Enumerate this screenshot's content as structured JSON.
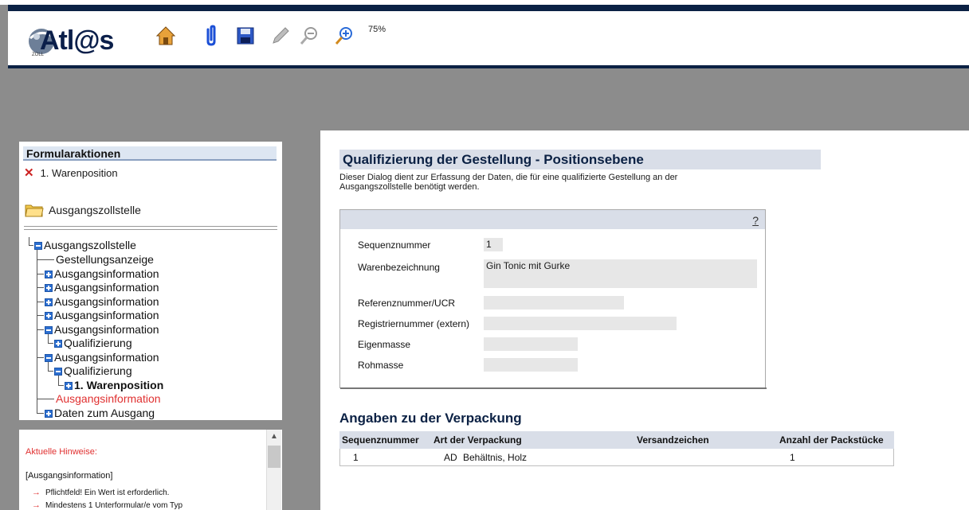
{
  "app": {
    "logo_text": "Atl@s",
    "logo_sub": "ZOLL",
    "zoom_level": "75%"
  },
  "toolbar": {
    "icons": [
      "home-icon",
      "paperclip-icon",
      "save-icon",
      "pencil-icon",
      "zoom-out-icon",
      "zoom-in-icon"
    ]
  },
  "formular_aktionen": {
    "title": "Formularaktionen",
    "item_label": "1. Warenposition",
    "folder_label": "Ausgangszollstelle"
  },
  "tree": [
    {
      "label": "Ausgangszollstelle",
      "box": "minus",
      "level": 0
    },
    {
      "label": "Gestellungsanzeige",
      "box": "none",
      "level": 1
    },
    {
      "label": "Ausgangsinformation",
      "box": "plus",
      "level": 1
    },
    {
      "label": "Ausgangsinformation",
      "box": "plus",
      "level": 1
    },
    {
      "label": "Ausgangsinformation",
      "box": "plus",
      "level": 1
    },
    {
      "label": "Ausgangsinformation",
      "box": "plus",
      "level": 1
    },
    {
      "label": "Ausgangsinformation",
      "box": "minus",
      "level": 1
    },
    {
      "label": "Qualifizierung",
      "box": "plus",
      "level": 2
    },
    {
      "label": "Ausgangsinformation",
      "box": "minus",
      "level": 1
    },
    {
      "label": "Qualifizierung",
      "box": "minus",
      "level": 2
    },
    {
      "label": "1. Warenposition",
      "box": "plus",
      "level": 3,
      "bold": true
    },
    {
      "label": "Ausgangsinformation",
      "box": "none",
      "level": 1,
      "red": true
    },
    {
      "label": "Daten zum Ausgang",
      "box": "plus",
      "level": 1
    }
  ],
  "hints": {
    "title": "Aktuelle Hinweise:",
    "context": "[Ausgangsinformation]",
    "lines": [
      "Pflichtfeld! Ein Wert ist erforderlich.",
      "Mindestens 1 Unterformular/e vom Typ"
    ]
  },
  "main": {
    "title": "Qualifizierung der Gestellung - Positionsebene",
    "description": "Dieser Dialog dient zur Erfassung der Daten, die für eine qualifizierte Gestellung an der Ausgangszollstelle benötigt werden.",
    "help": "?",
    "fields": [
      {
        "label": "Sequenznummer",
        "value": "1"
      },
      {
        "label": "Warenbezeichnung",
        "value": "Gin Tonic mit Gurke"
      },
      {
        "label": "Referenznummer/UCR",
        "value": ""
      },
      {
        "label": "Registriernummer (extern)",
        "value": ""
      },
      {
        "label": "Eigenmasse",
        "value": ""
      },
      {
        "label": "Rohmasse",
        "value": ""
      }
    ]
  },
  "packaging": {
    "title": "Angaben zu der Verpackung",
    "headers": [
      "Sequenznummer",
      "Art der Verpackung",
      "Versandzeichen",
      "Anzahl der Packstücke"
    ],
    "rows": [
      {
        "seq": "1",
        "code": "AD",
        "art": "Behältnis, Holz",
        "versand": "",
        "anzahl": "1"
      }
    ]
  }
}
